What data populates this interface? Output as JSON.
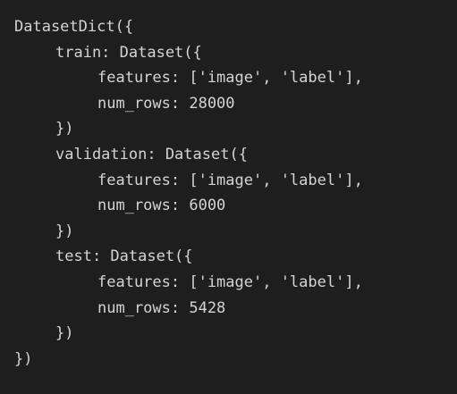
{
  "output": {
    "lines": [
      "DatasetDict({",
      "train: Dataset({",
      "features: ['image', 'label'],",
      "num_rows: 28000",
      "})",
      "validation: Dataset({",
      "features: ['image', 'label'],",
      "num_rows: 6000",
      "})",
      "test: Dataset({",
      "features: ['image', 'label'],",
      "num_rows: 5428",
      "})",
      "})"
    ]
  },
  "colors": {
    "background": "#1e1e1e",
    "text": "#d4d4d4"
  }
}
